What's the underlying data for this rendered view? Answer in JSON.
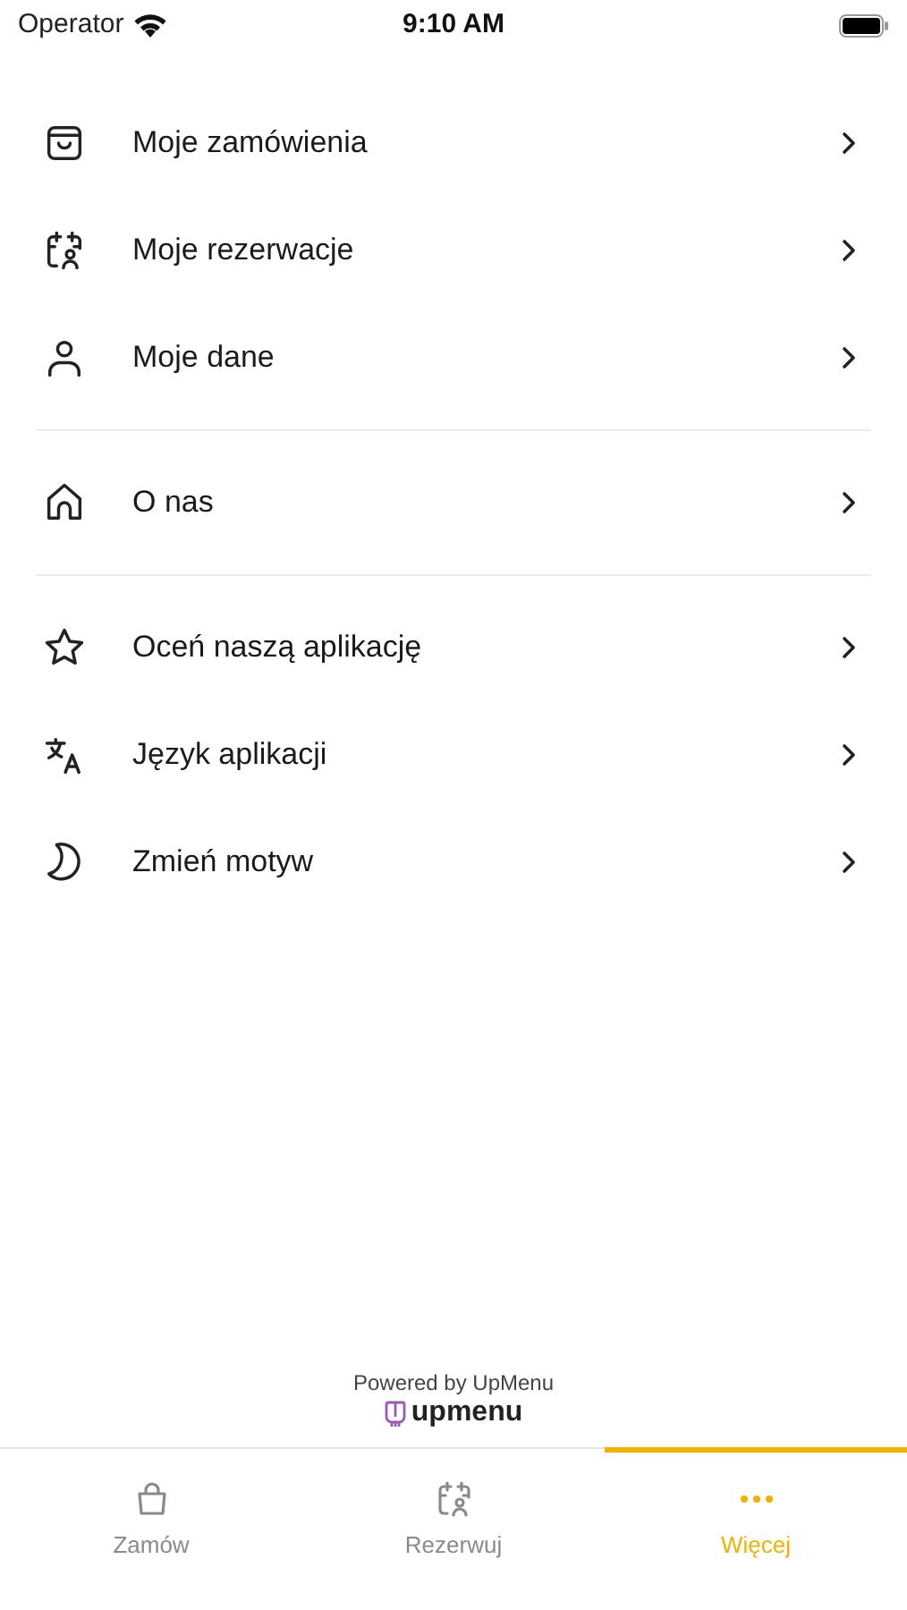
{
  "status_bar": {
    "carrier": "Operator",
    "time": "9:10 AM"
  },
  "menu_groups": [
    [
      {
        "kind": "bag",
        "label": "Moje zamówienia"
      },
      {
        "kind": "calendar",
        "label": "Moje rezerwacje"
      },
      {
        "kind": "person",
        "label": "Moje dane"
      }
    ],
    [
      {
        "kind": "home",
        "label": "O nas"
      }
    ],
    [
      {
        "kind": "star",
        "label": "Oceń naszą aplikację"
      },
      {
        "kind": "translate",
        "label": "Język aplikacji"
      },
      {
        "kind": "moon",
        "label": "Zmień motyw"
      }
    ]
  ],
  "footer": {
    "powered_by": "Powered by UpMenu",
    "logo_text": "upmenu"
  },
  "tabs": [
    {
      "kind": "bag",
      "label": "Zamów",
      "selected": false
    },
    {
      "kind": "calendar",
      "label": "Rezerwuj",
      "selected": false
    },
    {
      "kind": "dots",
      "label": "Więcej",
      "selected": true
    }
  ]
}
